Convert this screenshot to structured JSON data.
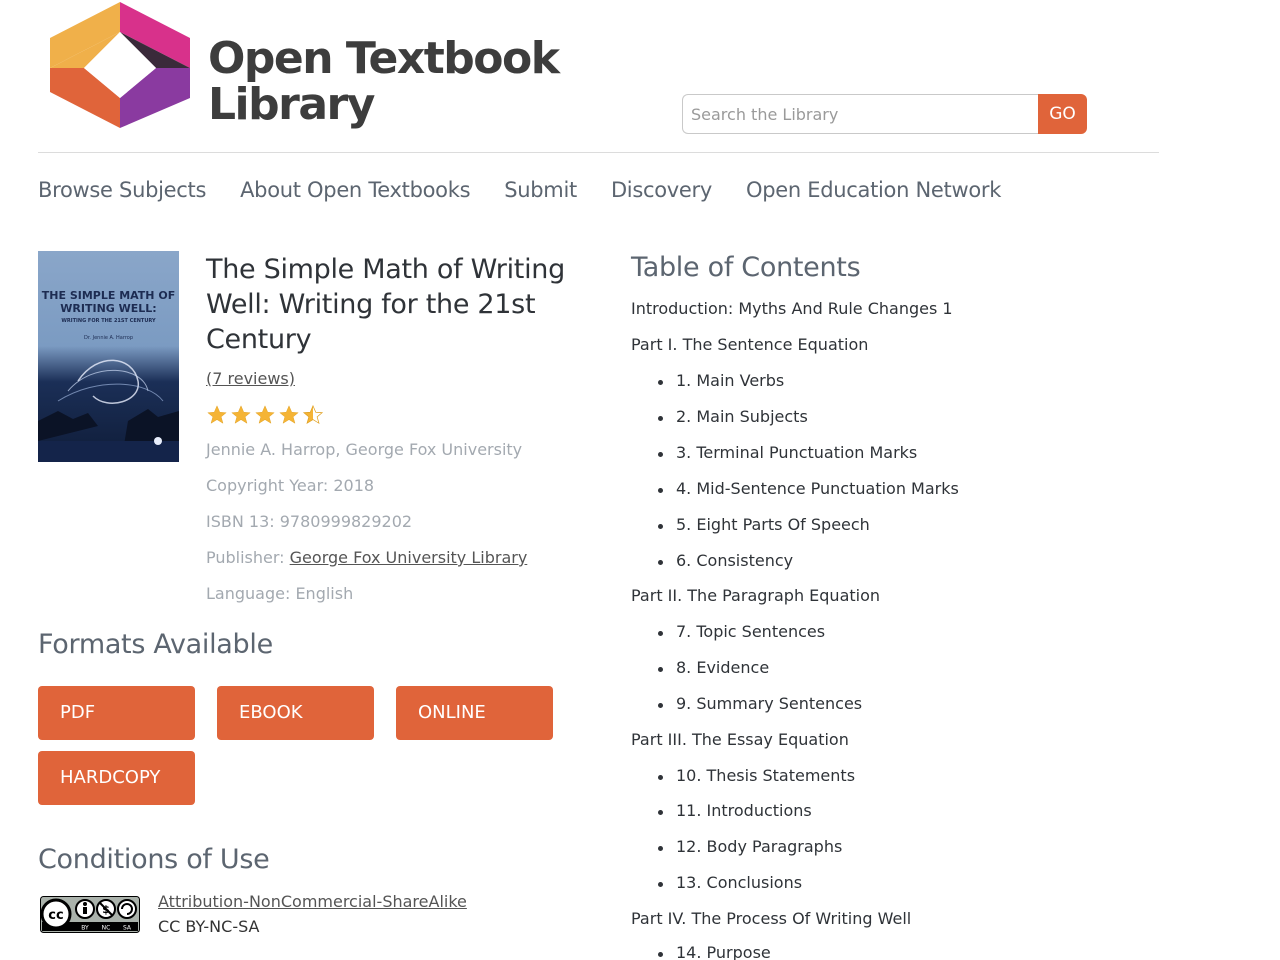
{
  "brand": {
    "line1": "Open Textbook",
    "line2": "Library"
  },
  "search": {
    "placeholder": "Search the Library",
    "button": "GO"
  },
  "nav": [
    "Browse Subjects",
    "About Open Textbooks",
    "Submit",
    "Discovery",
    "Open Education Network"
  ],
  "book": {
    "cover": {
      "title": "THE SIMPLE MATH OF WRITING WELL:",
      "subtitle": "WRITING FOR THE 21ST CENTURY",
      "author": "Dr. Jennie A. Harrop"
    },
    "title": "The Simple Math of Writing Well: Writing for the 21st Century",
    "reviews": "(7 reviews)",
    "rating": 4.5,
    "authors": "Jennie A. Harrop, George Fox University",
    "copyright": "Copyright Year: 2018",
    "isbn": "ISBN 13: 9780999829202",
    "publisher_label": "Publisher: ",
    "publisher": "George Fox University Library",
    "language": "Language: English"
  },
  "formats": {
    "heading": "Formats Available",
    "buttons": [
      "PDF",
      "EBOOK",
      "ONLINE",
      "HARDCOPY"
    ]
  },
  "conditions": {
    "heading": "Conditions of Use",
    "license_name": "Attribution-NonCommercial-ShareAlike",
    "license_code": "CC BY-NC-SA"
  },
  "toc": {
    "heading": "Table of Contents",
    "items": [
      "Introduction: Myths And Rule Changes 1",
      "Part I. The Sentence Equation",
      "1. Main Verbs",
      "2. Main Subjects",
      "3. Terminal Punctuation Marks",
      "4. Mid-Sentence Punctuation Marks",
      "5. Eight Parts Of Speech",
      "6. Consistency",
      "Part II. The Paragraph Equation",
      "7. Topic Sentences",
      "8. Evidence",
      "9. Summary Sentences",
      "Part III. The Essay Equation",
      "10. Thesis Statements",
      "11. Introductions",
      "12. Body Paragraphs",
      "13. Conclusions",
      "Part IV. The Process Of Writing Well",
      "14. Purpose"
    ]
  },
  "colors": {
    "accent": "#e0643a",
    "text": "#2f3338",
    "muted": "#a3a9b0",
    "nav": "#5c6570"
  }
}
